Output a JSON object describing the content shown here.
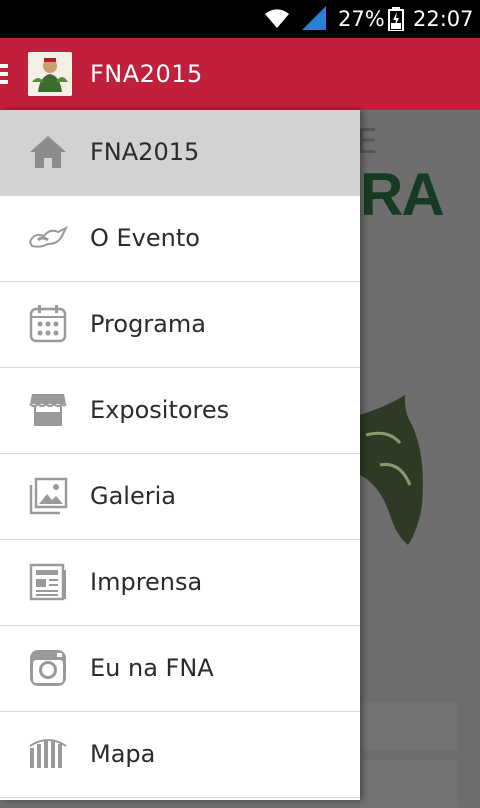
{
  "status_bar": {
    "battery": "27%",
    "time": "22:07"
  },
  "app_bar": {
    "title": "FNA2015"
  },
  "background": {
    "heading_fragment": "RA",
    "letter_fragment": "E"
  },
  "menu": {
    "items": [
      {
        "label": "FNA2015",
        "icon": "home-icon",
        "active": true
      },
      {
        "label": "O Evento",
        "icon": "event-icon",
        "active": false
      },
      {
        "label": "Programa",
        "icon": "calendar-icon",
        "active": false
      },
      {
        "label": "Expositores",
        "icon": "stall-icon",
        "active": false
      },
      {
        "label": "Galeria",
        "icon": "gallery-icon",
        "active": false
      },
      {
        "label": "Imprensa",
        "icon": "newspaper-icon",
        "active": false
      },
      {
        "label": "Eu na FNA",
        "icon": "camera-icon",
        "active": false
      },
      {
        "label": "Mapa",
        "icon": "map-icon",
        "active": false
      }
    ]
  },
  "colors": {
    "app_bar": "#c0203c",
    "active_item": "#d2d2d2",
    "icon": "#9a9a9a"
  }
}
